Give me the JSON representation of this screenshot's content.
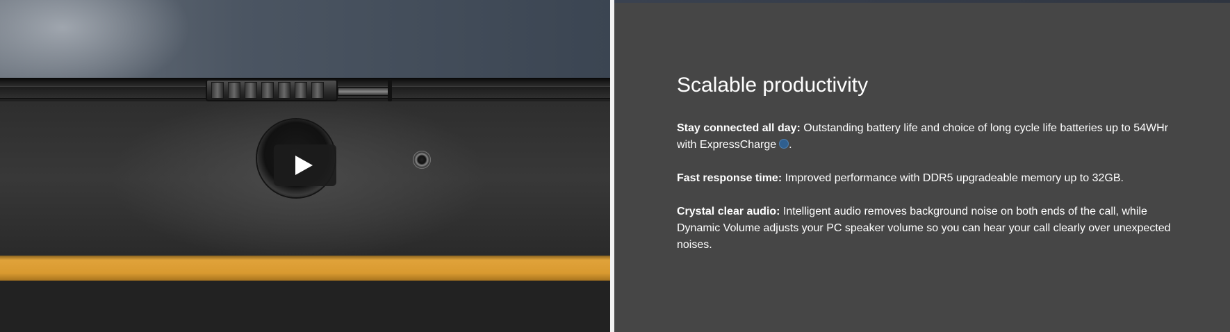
{
  "media": {
    "play_button_label": "Play video"
  },
  "content": {
    "title": "Scalable productivity",
    "features": [
      {
        "heading": "Stay connected all day:",
        "text": " Outstanding battery life and choice of long cycle life batteries up to 54WHr with ExpressCharge",
        "suffix": "."
      },
      {
        "heading": "Fast response time:",
        "text": " Improved performance with DDR5 upgradeable memory up to 32GB."
      },
      {
        "heading": "Crystal clear audio:",
        "text": " Intelligent audio removes background noise on both ends of the call, while Dynamic Volume adjusts your PC speaker volume so you can hear your call clearly over unexpected noises."
      }
    ],
    "info_icon": "info-circle-icon"
  },
  "colors": {
    "panel_background": "#464646",
    "accent_stripe": "#d99a30",
    "text": "#ffffff"
  }
}
